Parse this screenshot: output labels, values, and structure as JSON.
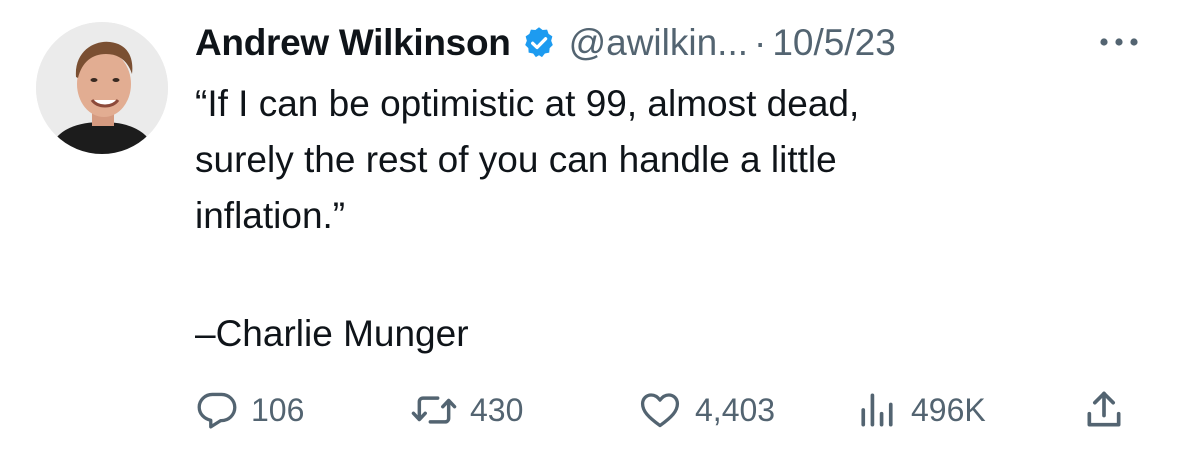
{
  "tweet": {
    "author": {
      "name": "Andrew Wilkinson",
      "handle": "@awilkin...",
      "verified": true,
      "verified_color": "#1d9bf0"
    },
    "separator": "·",
    "date": "10/5/23",
    "more_icon": "more-dots-icon",
    "text": "“If I can be optimistic at 99, almost dead,\nsurely the rest of you can handle a little\ninflation.”",
    "attribution": "–Charlie Munger",
    "actions": {
      "replies": "106",
      "retweets": "430",
      "likes": "4,403",
      "views": "496K"
    },
    "icons": {
      "reply": "reply-icon",
      "retweet": "retweet-icon",
      "like": "heart-icon",
      "views": "views-chart-icon",
      "share": "share-icon"
    },
    "colors": {
      "text": "#0f1419",
      "secondary": "#536471"
    }
  }
}
